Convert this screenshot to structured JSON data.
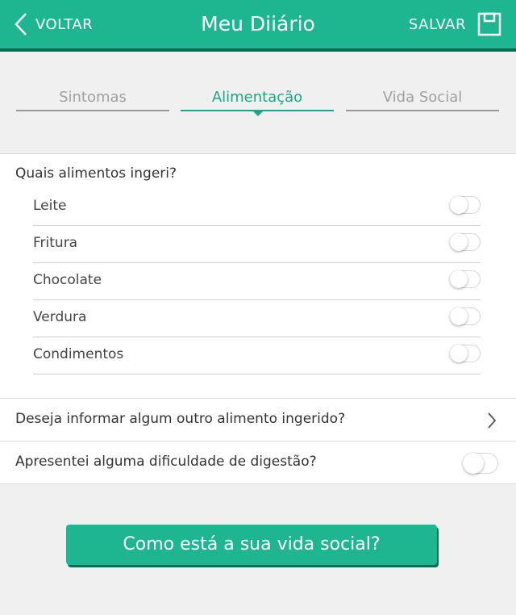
{
  "header": {
    "back_label": "VOLTAR",
    "title": "Meu Diiário",
    "save_label": "SALVAR"
  },
  "tabs": [
    {
      "label": "Sintomas",
      "active": false
    },
    {
      "label": "Alimentação",
      "active": true
    },
    {
      "label": "Vida Social",
      "active": false
    }
  ],
  "food": {
    "question": "Quais alimentos ingeri?",
    "items": [
      {
        "label": "Leite",
        "on": false
      },
      {
        "label": "Fritura",
        "on": false
      },
      {
        "label": "Chocolate",
        "on": false
      },
      {
        "label": "Verdura",
        "on": false
      },
      {
        "label": "Condimentos",
        "on": false
      }
    ]
  },
  "other_food": {
    "label": "Deseja informar algum outro alimento ingerido?"
  },
  "digestion": {
    "label": "Apresentei alguma dificuldade de digestão?",
    "on": false
  },
  "cta": {
    "label": "Como está a sua vida social?"
  },
  "colors": {
    "accent": "#1db691",
    "accent_dark": "#0b6b55"
  }
}
